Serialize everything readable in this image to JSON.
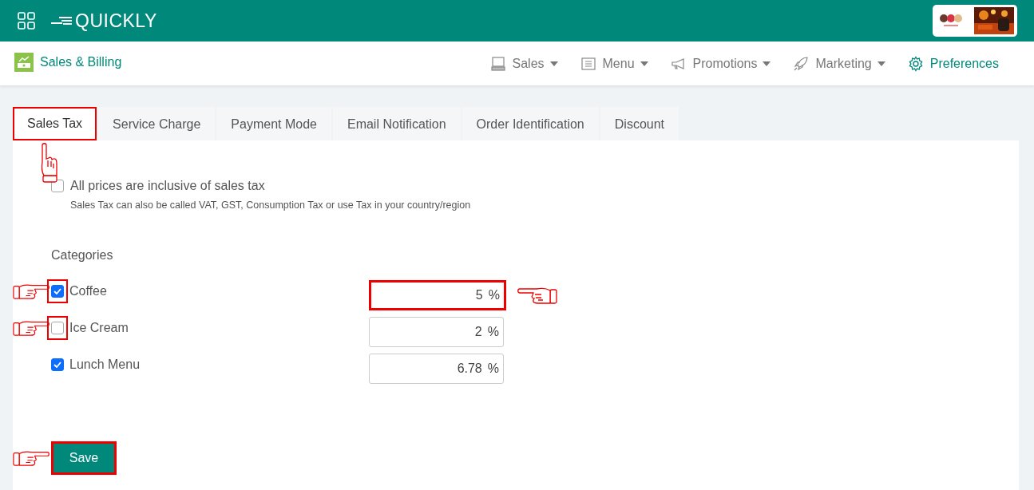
{
  "header": {
    "brand": "QUICKLY"
  },
  "subheader": {
    "title": "Sales & Billing",
    "nav": [
      {
        "label": "Sales",
        "dropdown": true,
        "selected": false
      },
      {
        "label": "Menu",
        "dropdown": true,
        "selected": false
      },
      {
        "label": "Promotions",
        "dropdown": true,
        "selected": false
      },
      {
        "label": "Marketing",
        "dropdown": true,
        "selected": false
      },
      {
        "label": "Preferences",
        "dropdown": false,
        "selected": true
      }
    ]
  },
  "tabs": [
    {
      "label": "Sales Tax",
      "selected": true,
      "highlighted": true
    },
    {
      "label": "Service Charge",
      "selected": false,
      "highlighted": false
    },
    {
      "label": "Payment Mode",
      "selected": false,
      "highlighted": false
    },
    {
      "label": "Email Notification",
      "selected": false,
      "highlighted": false
    },
    {
      "label": "Order Identification",
      "selected": false,
      "highlighted": false
    },
    {
      "label": "Discount",
      "selected": false,
      "highlighted": false
    }
  ],
  "inclusive": {
    "label": "All prices are inclusive of sales tax",
    "note": "Sales Tax can also be called VAT, GST, Consumption Tax or use Tax in your country/region",
    "checked": false,
    "pointer": true
  },
  "categories_heading": "Categories",
  "categories": [
    {
      "name": "Coffee",
      "checked": true,
      "highlighted": true,
      "pointer": true,
      "rate": "5",
      "unit": "%",
      "rate_highlighted": true,
      "rate_pointer": true
    },
    {
      "name": "Ice Cream",
      "checked": false,
      "highlighted": true,
      "pointer": true,
      "rate": "2",
      "unit": "%",
      "rate_highlighted": false,
      "rate_pointer": false
    },
    {
      "name": "Lunch Menu",
      "checked": true,
      "highlighted": false,
      "pointer": false,
      "rate": "6.78",
      "unit": "%",
      "rate_highlighted": false,
      "rate_pointer": false
    }
  ],
  "save": {
    "label": "Save",
    "highlighted": true,
    "pointer": true
  }
}
